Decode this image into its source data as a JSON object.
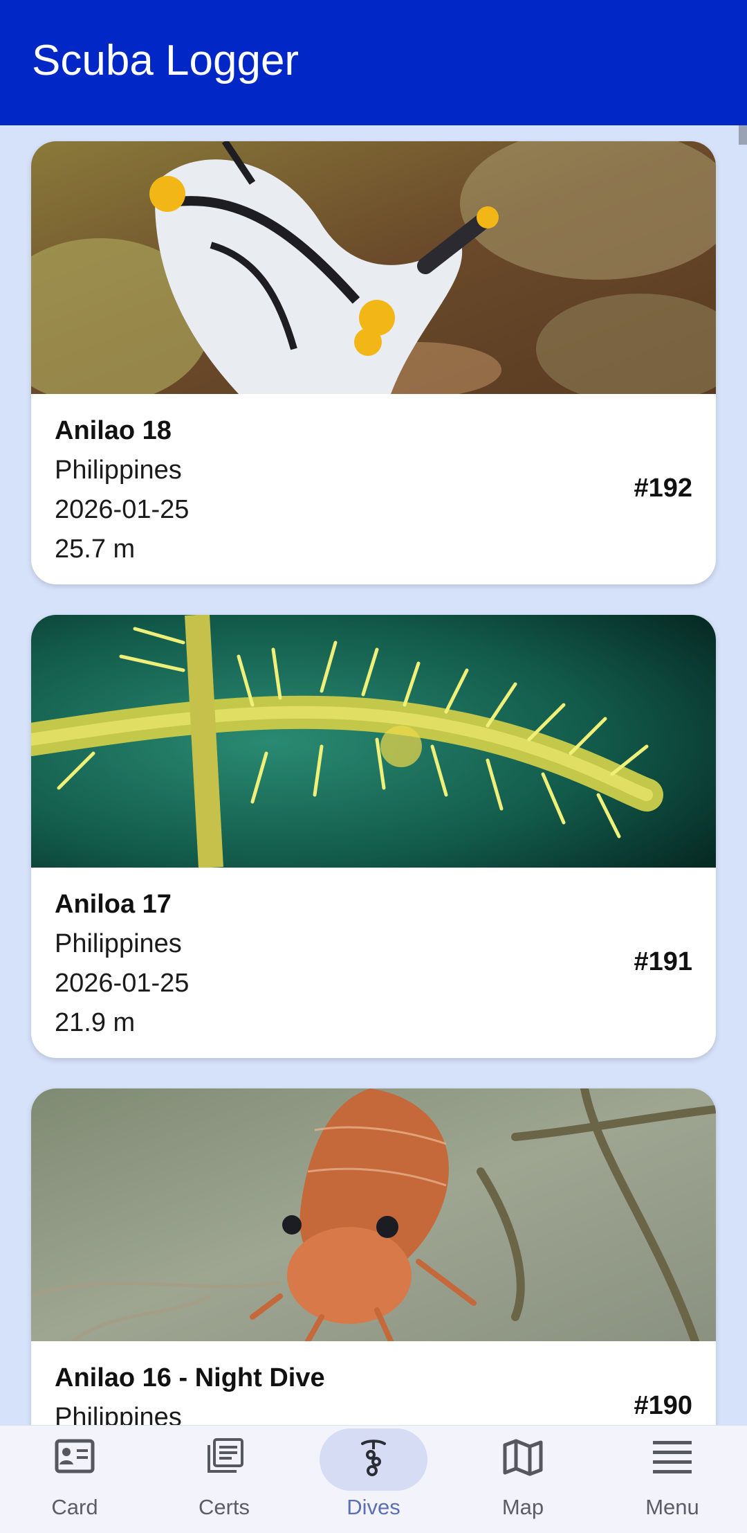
{
  "app_bar": {
    "title": "Scuba Logger"
  },
  "dives": [
    {
      "title": "Anilao 18",
      "country": "Philippines",
      "date": "2026-01-25",
      "depth": "25.7 m",
      "number": "#192",
      "photo": "nudibranch"
    },
    {
      "title": "Aniloa 17",
      "country": "Philippines",
      "date": "2026-01-25",
      "depth": "21.9 m",
      "number": "#191",
      "photo": "ghost-pipefish"
    },
    {
      "title": "Anilao 16 - Night Dive",
      "country": "Philippines",
      "date": "",
      "depth": "",
      "number": "#190",
      "photo": "shrimp"
    }
  ],
  "bottom_nav": {
    "active": "dives",
    "items": [
      {
        "id": "card",
        "label": "Card",
        "icon": "id-card-icon"
      },
      {
        "id": "certs",
        "label": "Certs",
        "icon": "certificates-icon"
      },
      {
        "id": "dives",
        "label": "Dives",
        "icon": "diver-icon"
      },
      {
        "id": "map",
        "label": "Map",
        "icon": "map-icon"
      },
      {
        "id": "menu",
        "label": "Menu",
        "icon": "hamburger-menu-icon"
      }
    ]
  },
  "colors": {
    "app_bar": "#0227c7",
    "background": "#d6e2fa",
    "nav_active_pill": "#d6dcf4",
    "nav_active_label": "#5c6fb6"
  }
}
